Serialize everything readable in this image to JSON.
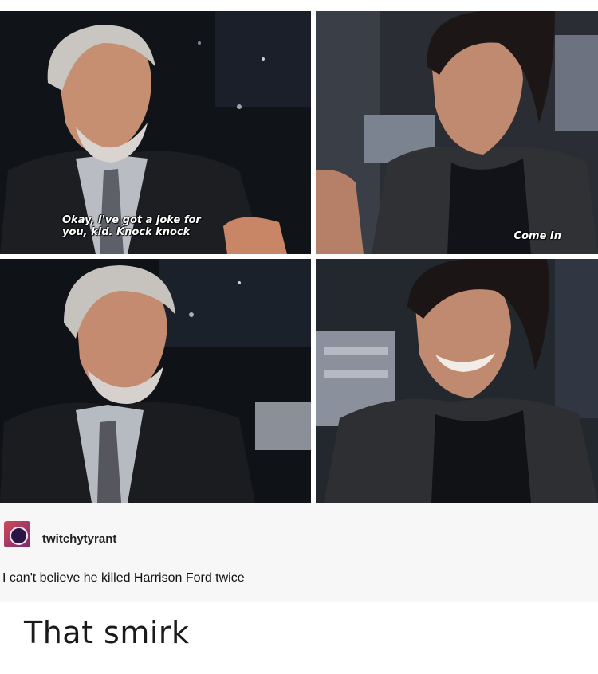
{
  "meme": {
    "panels": [
      {
        "caption": "Okay, I've got a joke for\nyou, kid. Knock knock"
      },
      {
        "caption": "Come In"
      },
      {
        "caption": ""
      },
      {
        "caption": ""
      }
    ]
  },
  "post": {
    "username": "twitchytyrant",
    "text": "I can't believe he killed Harrison Ford twice"
  },
  "comment": "That smirk"
}
